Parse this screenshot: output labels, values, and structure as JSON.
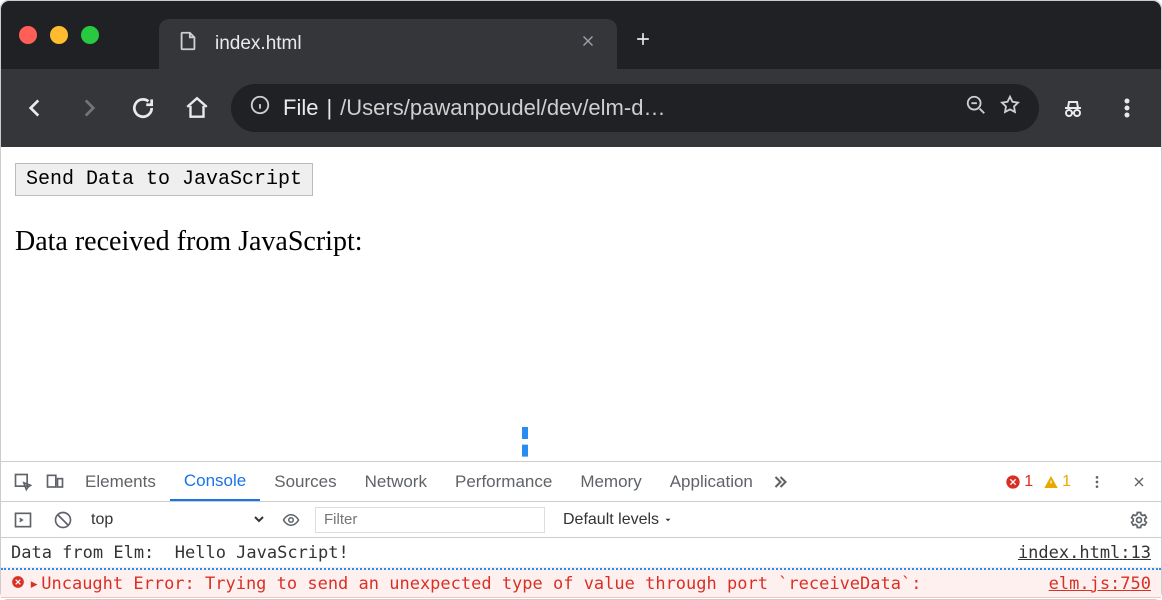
{
  "window": {
    "tab_title": "index.html"
  },
  "omnibox": {
    "scheme": "File",
    "path": "/Users/pawanpoudel/dev/elm-d…"
  },
  "page": {
    "send_button_label": "Send Data to JavaScript",
    "received_label": "Data received from JavaScript:"
  },
  "devtools": {
    "tabs": [
      "Elements",
      "Console",
      "Sources",
      "Network",
      "Performance",
      "Memory",
      "Application"
    ],
    "active_tab": "Console",
    "error_count": "1",
    "warning_count": "1",
    "context": "top",
    "filter_placeholder": "Filter",
    "levels_label": "Default levels",
    "logs": [
      {
        "kind": "log",
        "text": "Data from Elm:  Hello JavaScript!",
        "source": "index.html:13"
      },
      {
        "kind": "error",
        "text": "Uncaught Error: Trying to send an unexpected type of value through port `receiveData`:",
        "source": "elm.js:750"
      }
    ]
  }
}
